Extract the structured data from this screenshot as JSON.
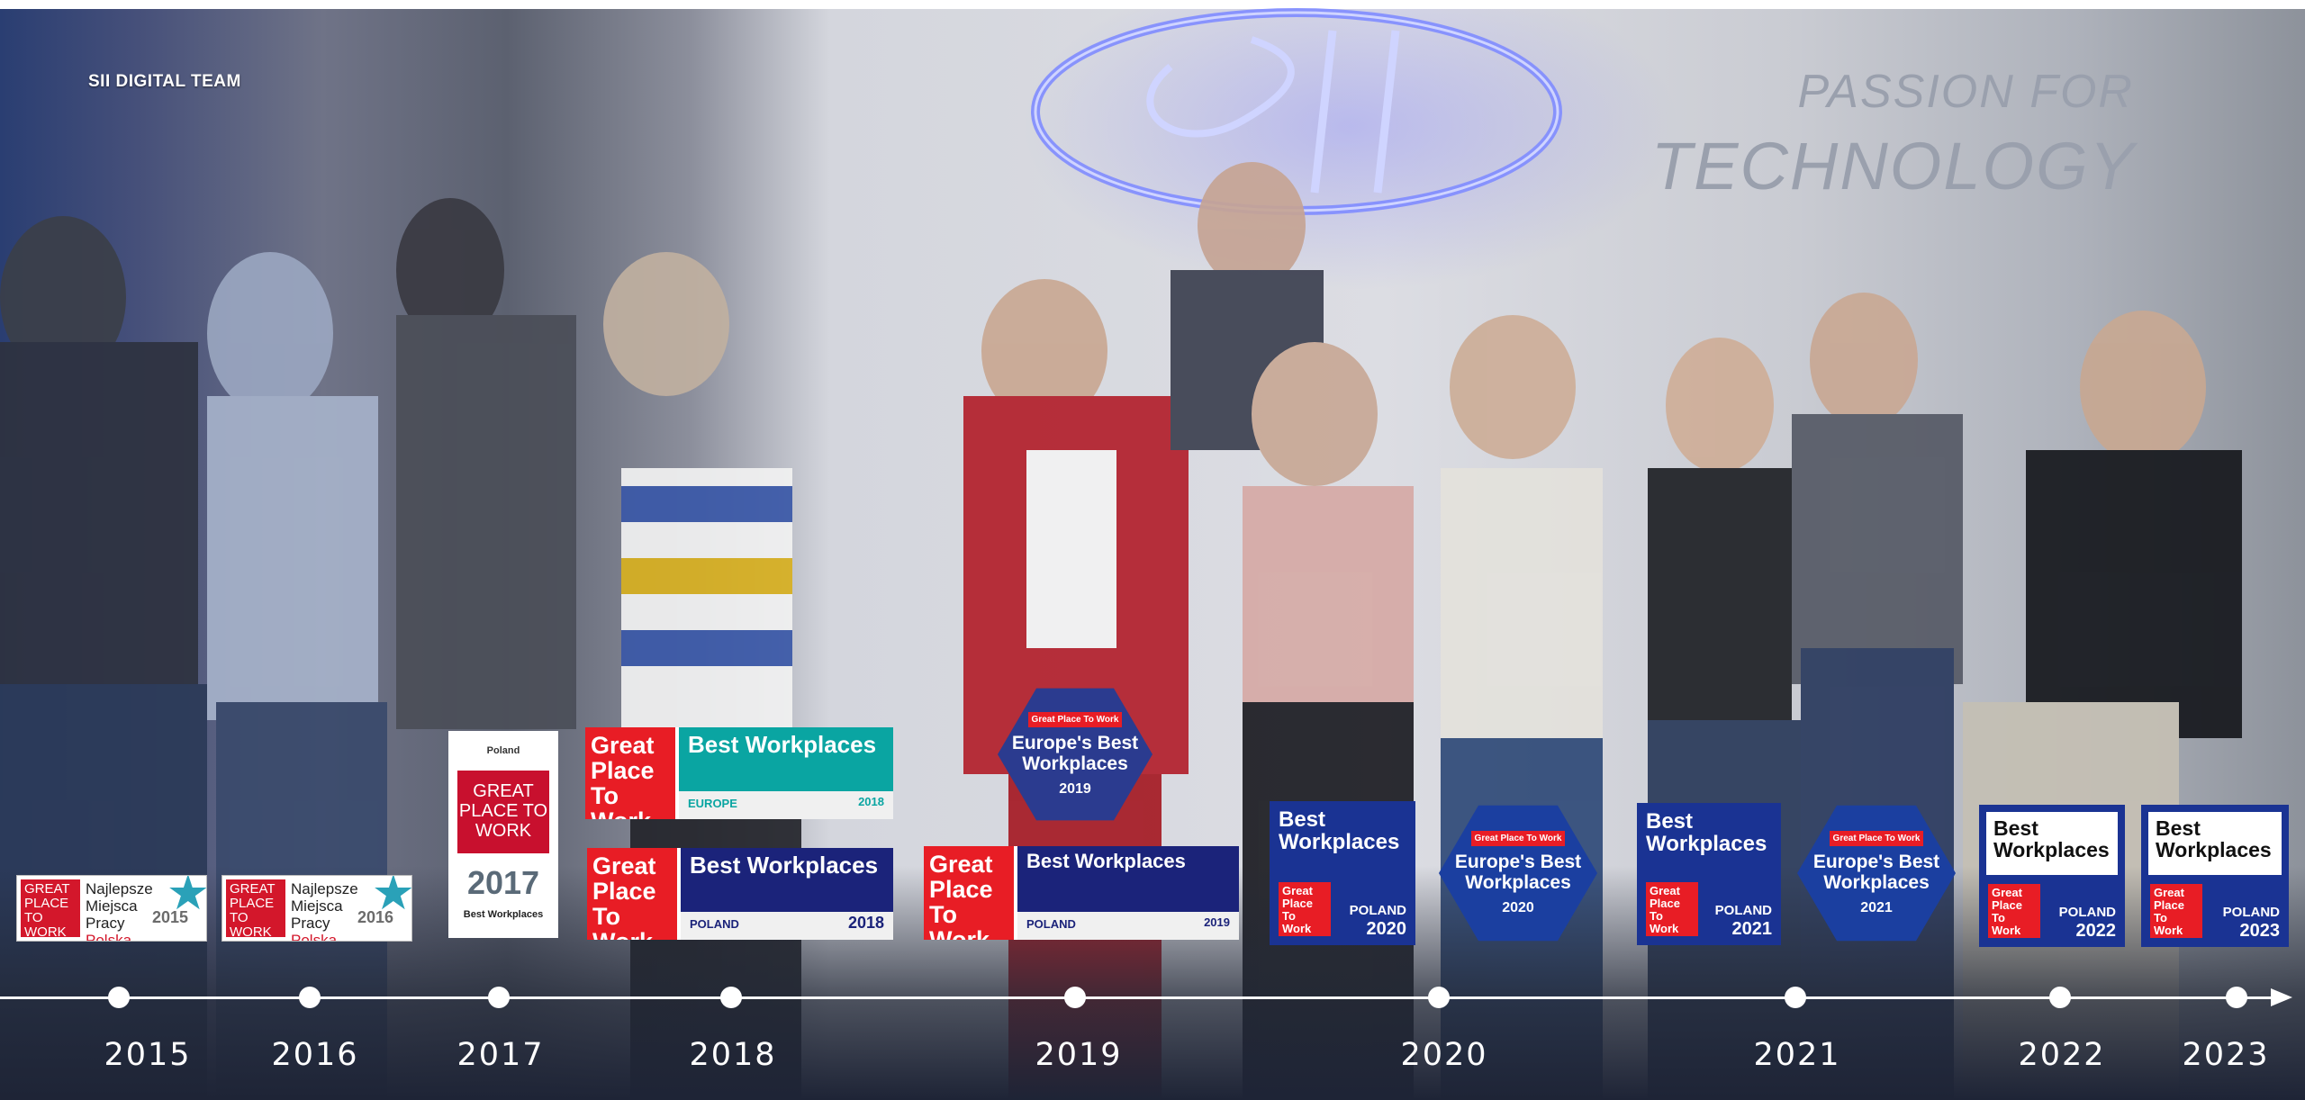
{
  "header": {
    "team_label": "SII DIGITAL TEAM"
  },
  "wall": {
    "line1": "PASSION FOR",
    "line2": "TECHNOLOGY"
  },
  "badges": {
    "b2015": {
      "logo": "GREAT PLACE TO WORK",
      "line1": "Najlepsze",
      "line2": "Miejsca",
      "line3": "Pracy",
      "country": "Polska",
      "year": "2015"
    },
    "b2016": {
      "logo": "GREAT PLACE TO WORK",
      "line1": "Najlepsze",
      "line2": "Miejsca",
      "line3": "Pracy",
      "country": "Polska",
      "year": "2016"
    },
    "b2017": {
      "country": "Poland",
      "logo": "GREAT PLACE TO WORK",
      "year": "2017",
      "title": "Best Workplaces"
    },
    "b2018_europe": {
      "logo": "Great Place To Work",
      "title": "Best Workplaces",
      "region": "EUROPE",
      "year": "2018"
    },
    "b2018_poland": {
      "logo": "Great Place To Work",
      "title": "Best Workplaces",
      "country": "POLAND",
      "year": "2018"
    },
    "b2019_europe": {
      "logo": "Great Place To Work",
      "title": "Europe's Best Workplaces",
      "year": "2019"
    },
    "b2019_poland": {
      "logo": "Great Place To Work",
      "title": "Best Workplaces",
      "country": "POLAND",
      "year": "2019"
    },
    "b2020_poland": {
      "title": "Best Workplaces",
      "logo": "Great Place To Work",
      "country": "POLAND",
      "year": "2020"
    },
    "b2020_europe": {
      "logo": "Great Place To Work",
      "title": "Europe's Best Workplaces",
      "year": "2020"
    },
    "b2021_poland": {
      "title": "Best Workplaces",
      "logo": "Great Place To Work",
      "country": "POLAND",
      "year": "2021"
    },
    "b2021_europe": {
      "logo": "Great Place To Work",
      "title": "Europe's Best Workplaces",
      "year": "2021"
    },
    "b2022_poland": {
      "title": "Best Workplaces",
      "logo": "Great Place To Work",
      "country": "POLAND",
      "year": "2022"
    },
    "b2023_poland": {
      "title": "Best Workplaces",
      "logo": "Great Place To Work",
      "country": "POLAND",
      "year": "2023"
    }
  },
  "timeline": {
    "years": [
      "2015",
      "2016",
      "2017",
      "2018",
      "2019",
      "2020",
      "2021",
      "2022",
      "2023"
    ]
  }
}
